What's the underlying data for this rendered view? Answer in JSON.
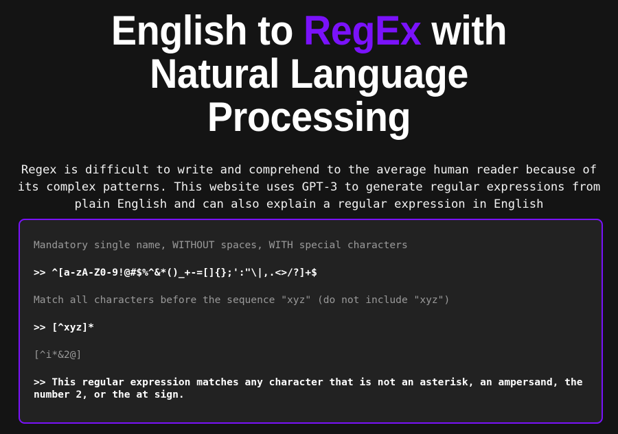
{
  "page": {
    "background_color": "#141414",
    "accent_color": "#7a12fa",
    "box_background_color": "#222222",
    "prompt_text_color": "#9a9a9a",
    "response_text_color": "#ffffff"
  },
  "header": {
    "title_part1": "English to ",
    "title_accent": "RegEx",
    "title_part2": " with Natural Language Processing",
    "full_title": "English to RegEx with Natural Language Processing"
  },
  "intro": {
    "description": "Regex is difficult to write and comprehend to the average human reader because of its complex patterns. This website uses GPT-3 to generate regular expressions from plain English and can also explain a regular expression in English"
  },
  "console": {
    "entries": [
      {
        "type": "prompt",
        "text": "Mandatory single name, WITHOUT spaces, WITH special characters"
      },
      {
        "type": "response",
        "text": ">> ^[a-zA-Z0-9!@#$%^&*()_+-=[]{};':\"\\|,.<>/?]+$"
      },
      {
        "type": "prompt",
        "text": "Match all characters before the sequence \"xyz\" (do not include \"xyz\")"
      },
      {
        "type": "response",
        "text": ">> [^xyz]*"
      },
      {
        "type": "prompt",
        "text": "[^i*&2@]"
      },
      {
        "type": "response",
        "text": ">> This regular expression matches any character that is not an asterisk, an ampersand, the number 2, or the at sign."
      }
    ]
  }
}
